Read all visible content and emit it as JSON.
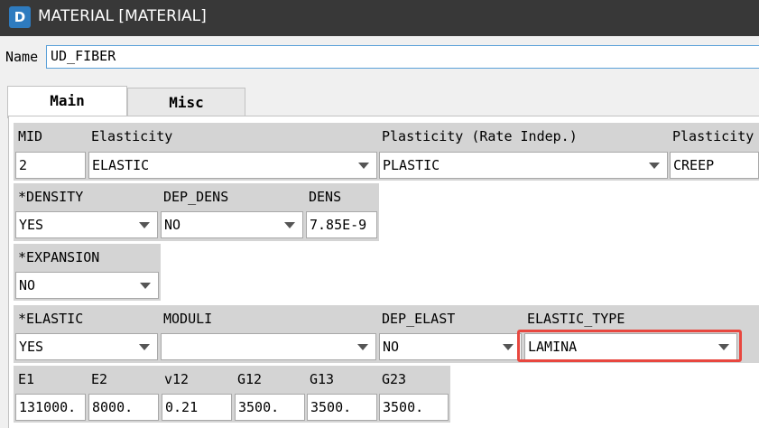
{
  "window": {
    "title": "MATERIAL [MATERIAL]",
    "icon": "app-logo-icon"
  },
  "name_field": {
    "label": "Name",
    "value": "UD_FIBER"
  },
  "tabs": [
    {
      "label": "Main",
      "active": true
    },
    {
      "label": "Misc",
      "active": false
    }
  ],
  "headers": {
    "mid": "MID",
    "elasticity": "Elasticity",
    "plasticity_rate": "Plasticity (Rate Indep.)",
    "plasticity2": "Plasticity",
    "density": "*DENSITY",
    "dep_dens": "DEP_DENS",
    "dens": "DENS",
    "expansion": "*EXPANSION",
    "elastic": "*ELASTIC",
    "moduli": "MODULI",
    "dep_elast": "DEP_ELAST",
    "elastic_type": "ELASTIC_TYPE",
    "e1": "E1",
    "e2": "E2",
    "v12": "v12",
    "g12": "G12",
    "g13": "G13",
    "g23": "G23"
  },
  "values": {
    "mid": "2",
    "elasticity": "ELASTIC",
    "plasticity_rate": "PLASTIC",
    "plasticity2": "CREEP",
    "density": "YES",
    "dep_dens": "NO",
    "dens": "7.85E-9",
    "expansion": "NO",
    "elastic": "YES",
    "moduli": "",
    "dep_elast": "NO",
    "elastic_type": "LAMINA",
    "e1": "131000.",
    "e2": "8000.",
    "v12": "0.21",
    "g12": "3500.",
    "g13": "3500.",
    "g23": "3500."
  },
  "highlight_color": "#e8473f",
  "accent_color": "#2e7bbf"
}
